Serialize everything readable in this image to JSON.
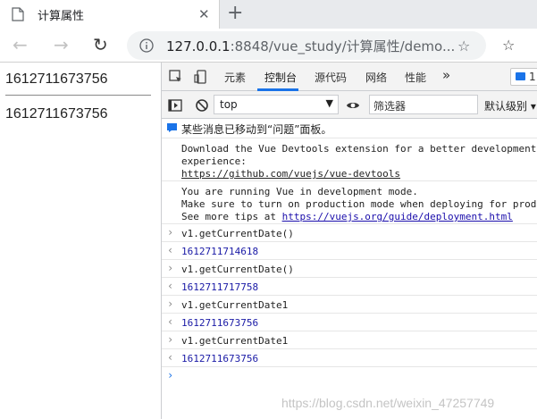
{
  "tab": {
    "title": "计算属性",
    "close": "✕",
    "new_tab": "+"
  },
  "toolbar": {
    "back": "←",
    "forward": "→",
    "reload": "↻",
    "url_host": "127.0.0.1",
    "url_rest": ":8848/vue_study/计算属性/demo...",
    "fav_add": "☆",
    "favorites": "☆"
  },
  "page": {
    "value1": "1612711673756",
    "value2": "1612711673756"
  },
  "devtools": {
    "tabs": [
      "元素",
      "控制台",
      "源代码",
      "网络",
      "性能"
    ],
    "more": "»",
    "issue_count": "1",
    "context": "top",
    "filter_placeholder": "筛选器",
    "levels": "默认级别",
    "levels_arrow": "▾",
    "select_arrow": "▼"
  },
  "console": {
    "notice": "某些消息已移动到“问题”面板。",
    "devtools_msg": [
      "Download the Vue Devtools extension for a better development",
      "experience:"
    ],
    "devtools_link": "https://github.com/vuejs/vue-devtools",
    "dev_mode": [
      "You are running Vue in development mode.",
      "Make sure to turn on production mode when deploying for produc"
    ],
    "tips_prefix": "See more tips at ",
    "tips_link": "https://vuejs.org/guide/deployment.html",
    "entries": [
      {
        "input": "v1.getCurrentDate()",
        "output": "1612711714618"
      },
      {
        "input": "v1.getCurrentDate()",
        "output": "1612711717758"
      },
      {
        "input": "v1.getCurrentDate1",
        "output": "1612711673756"
      },
      {
        "input": "v1.getCurrentDate1",
        "output": "1612711673756"
      }
    ],
    "prompt_glyph": "›",
    "output_glyph": "‹"
  },
  "watermark": "https://blog.csdn.net/weixin_47257749"
}
